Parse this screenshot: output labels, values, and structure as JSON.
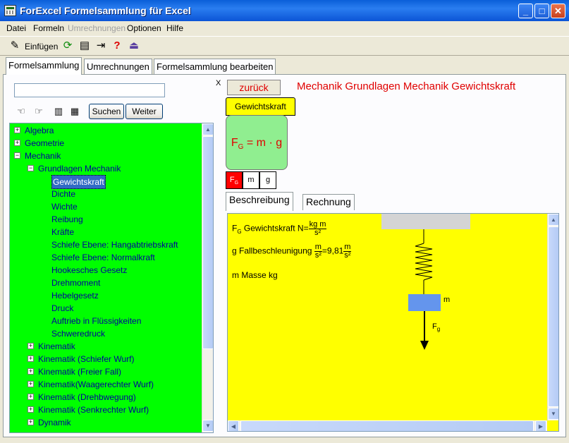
{
  "window": {
    "title": "ForExcel Formelsammlung für Excel"
  },
  "menu": [
    "Datei",
    "Formeln",
    "Umrechnungen",
    "Optionen",
    "Hilfe"
  ],
  "toolbar": {
    "insert_label": "Einfügen"
  },
  "tabs": [
    "Formelsammlung",
    "Umrechnungen",
    "Formelsammlung bearbeiten"
  ],
  "left": {
    "close": "X",
    "search_value": "",
    "search_button": "Suchen",
    "next_button": "Weiter",
    "tree": [
      {
        "label": "Algebra",
        "level": 0,
        "expander": "+"
      },
      {
        "label": "Geometrie",
        "level": 0,
        "expander": "+"
      },
      {
        "label": "Mechanik",
        "level": 0,
        "expander": "−"
      },
      {
        "label": "Grundlagen Mechanik",
        "level": 1,
        "expander": "−"
      },
      {
        "label": "Gewichtskraft",
        "level": 2,
        "expander": "",
        "selected": true
      },
      {
        "label": "Dichte",
        "level": 2,
        "expander": ""
      },
      {
        "label": "Wichte",
        "level": 2,
        "expander": ""
      },
      {
        "label": "Reibung",
        "level": 2,
        "expander": ""
      },
      {
        "label": "Kräfte",
        "level": 2,
        "expander": ""
      },
      {
        "label": "Schiefe Ebene: Hangabtriebskraft",
        "level": 2,
        "expander": ""
      },
      {
        "label": "Schiefe Ebene: Normalkraft",
        "level": 2,
        "expander": ""
      },
      {
        "label": "Hookesches Gesetz",
        "level": 2,
        "expander": ""
      },
      {
        "label": "Drehmoment",
        "level": 2,
        "expander": ""
      },
      {
        "label": "Hebelgesetz",
        "level": 2,
        "expander": ""
      },
      {
        "label": "Druck",
        "level": 2,
        "expander": ""
      },
      {
        "label": "Auftrieb in Flüssigkeiten",
        "level": 2,
        "expander": ""
      },
      {
        "label": "Schweredruck",
        "level": 2,
        "expander": ""
      },
      {
        "label": "Kinematik",
        "level": 1,
        "expander": "+"
      },
      {
        "label": "Kinematik (Schiefer Wurf)",
        "level": 1,
        "expander": "+"
      },
      {
        "label": "Kinematik (Freier Fall)",
        "level": 1,
        "expander": "+"
      },
      {
        "label": "Kinematik(Waagerechter Wurf)",
        "level": 1,
        "expander": "+"
      },
      {
        "label": "Kinematik (Drehbwegung)",
        "level": 1,
        "expander": "+"
      },
      {
        "label": "Kinematik (Senkrechter Wurf)",
        "level": 1,
        "expander": "+"
      },
      {
        "label": "Dynamik",
        "level": 1,
        "expander": "+"
      }
    ]
  },
  "right": {
    "back_button": "zurück",
    "breadcrumb": "Mechanik  Grundlagen Mechanik  Gewichtskraft",
    "formula_tab": "Gewichtskraft",
    "formula": {
      "lhs": "F",
      "lhs_sub": "G",
      "rhs": " = m · g"
    },
    "variables": [
      {
        "sym": "F",
        "sub": "G",
        "active": true
      },
      {
        "sym": "m",
        "sub": "",
        "active": false
      },
      {
        "sym": "g",
        "sub": "",
        "active": false
      }
    ],
    "subtabs": [
      "Beschreibung",
      "Rechnung"
    ],
    "description": {
      "line1": {
        "sym": "F",
        "sub": "G",
        "text": " Gewichtskraft N=",
        "num": "kg m",
        "den": "s²"
      },
      "line2": {
        "text": "g Fallbeschleunigung ",
        "num": "m",
        "den": "s²",
        "mid": "=9,81",
        "num2": "m",
        "den2": "s²"
      },
      "line3": "m Masse kg"
    },
    "diagram": {
      "mass_label": "m",
      "force_label": "F",
      "force_sub": "g"
    }
  },
  "colors": {
    "tree_bg": "#00ff00",
    "desc_bg": "#ffff00",
    "accent_red": "#e00000",
    "formula_bg": "#90ee90"
  }
}
